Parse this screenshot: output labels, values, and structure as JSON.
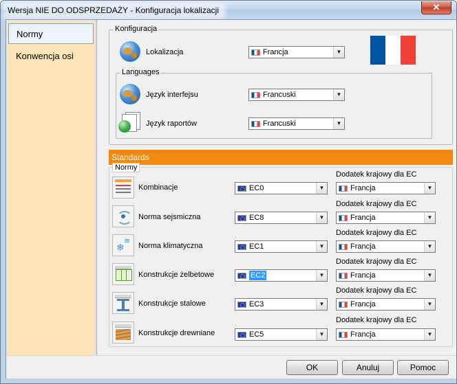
{
  "window": {
    "title": "Wersja NIE DO ODSPRZEDAŻY - Konfiguracja lokalizacji",
    "close_glyph": "✕"
  },
  "sidebar": {
    "items": [
      {
        "label": "Normy",
        "selected": true
      },
      {
        "label": "Konwencja osi",
        "selected": false
      }
    ]
  },
  "konfiguracja": {
    "label": "Konfiguracja",
    "lokalizacja_label": "Lokalizacja",
    "lokalizacja_value": "Francja",
    "flag": "france-flag"
  },
  "languages": {
    "label": "Languages",
    "interface_label": "Język interfejsu",
    "interface_value": "Francuski",
    "reports_label": "Język raportów",
    "reports_value": "Francuski"
  },
  "standards": {
    "header": "Standards",
    "group_label": "Normy",
    "annex_label": "Dodatek krajowy dla EC",
    "rows": [
      {
        "label": "Kombinacje",
        "value": "EC0",
        "annex": "Francja",
        "icon": "combinations-icon"
      },
      {
        "label": "Norma sejsmiczna",
        "value": "EC8",
        "annex": "Francja",
        "icon": "seismic-icon"
      },
      {
        "label": "Norma klimatyczna",
        "value": "EC1",
        "annex": "Francja",
        "icon": "climate-icon"
      },
      {
        "label": "Konstrukcje żelbetowe",
        "value": "EC2",
        "annex": "Francja",
        "icon": "concrete-icon"
      },
      {
        "label": "Konstrukcje stalowe",
        "value": "EC3",
        "annex": "Francja",
        "icon": "steel-icon"
      },
      {
        "label": "Konstrukcje drewniane",
        "value": "EC5",
        "annex": "Francja",
        "icon": "timber-icon"
      }
    ]
  },
  "buttons": {
    "ok": "OK",
    "cancel": "Anuluj",
    "help": "Pomoc"
  },
  "colors": {
    "accent": "#f5880f",
    "sidebar_bg": "#fde5b9",
    "flag_blue": "#0055a4",
    "flag_red": "#ef4135"
  }
}
